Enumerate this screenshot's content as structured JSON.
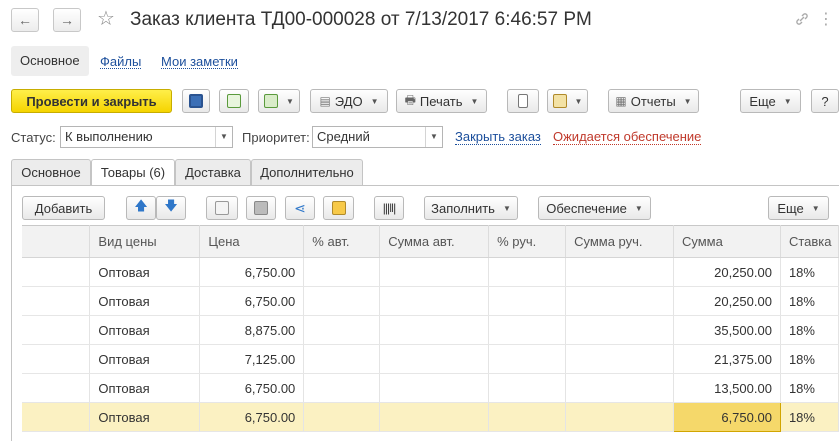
{
  "header": {
    "title": "Заказ клиента ТД00-000028 от 7/13/2017 6:46:57 PM",
    "back_icon": "←",
    "forward_icon": "→",
    "star_icon": "☆",
    "link_icon": "🔗",
    "more_icon": "⋮"
  },
  "nav_tabs": [
    {
      "label": "Основное"
    },
    {
      "label": "Файлы"
    },
    {
      "label": "Мои заметки"
    }
  ],
  "toolbar": {
    "post_close": "Провести и закрыть",
    "edo": "ЭДО",
    "print": "Печать",
    "reports": "Отчеты",
    "more": "Еще",
    "help": "?"
  },
  "status_row": {
    "status_label": "Статус:",
    "status_value": "К выполнению",
    "priority_label": "Приоритет:",
    "priority_value": "Средний",
    "close_order": "Закрыть заказ",
    "awaiting": "Ожидается обеспечение"
  },
  "tabs": [
    {
      "label": "Основное"
    },
    {
      "label": "Товары (6)"
    },
    {
      "label": "Доставка"
    },
    {
      "label": "Дополнительно"
    }
  ],
  "table_toolbar": {
    "add": "Добавить",
    "fill": "Заполнить",
    "provision": "Обеспечение",
    "more": "Еще"
  },
  "table": {
    "columns": [
      "Вид цены",
      "Цена",
      "% авт.",
      "Сумма авт.",
      "% руч.",
      "Сумма руч.",
      "Сумма",
      "Ставка"
    ],
    "rows": [
      {
        "price_type": "Оптовая",
        "price": "6,750.00",
        "sum": "20,250.00",
        "rate": "18%"
      },
      {
        "price_type": "Оптовая",
        "price": "6,750.00",
        "sum": "20,250.00",
        "rate": "18%"
      },
      {
        "price_type": "Оптовая",
        "price": "8,875.00",
        "sum": "35,500.00",
        "rate": "18%"
      },
      {
        "price_type": "Оптовая",
        "price": "7,125.00",
        "sum": "21,375.00",
        "rate": "18%"
      },
      {
        "price_type": "Оптовая",
        "price": "6,750.00",
        "sum": "13,500.00",
        "rate": "18%"
      },
      {
        "price_type": "Оптовая",
        "price": "6,750.00",
        "sum": "6,750.00",
        "rate": "18%"
      }
    ]
  },
  "colors": {
    "primary_button": "#f5d400",
    "link": "#1c4f9c",
    "warning_link": "#c0392b",
    "selected_row": "#fbf1c2",
    "current_cell": "#f5d86a"
  }
}
